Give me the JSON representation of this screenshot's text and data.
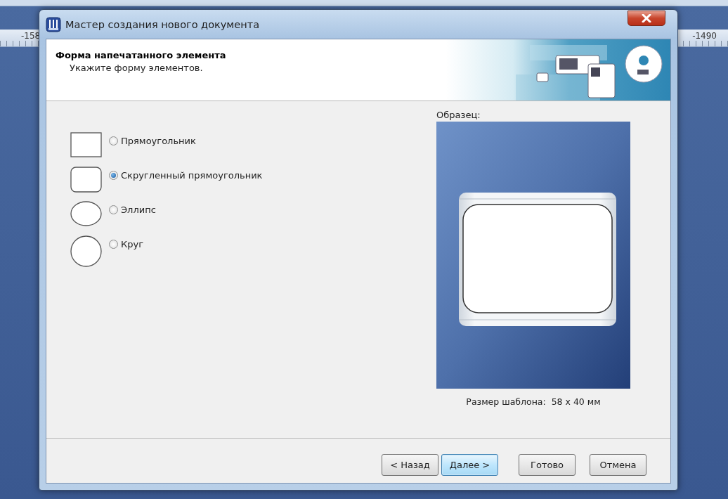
{
  "window": {
    "title": "Мастер создания нового документа"
  },
  "rulers": [
    "-158",
    "-1490"
  ],
  "header": {
    "title": "Форма напечатанного элемента",
    "subtitle": "Укажите форму элементов."
  },
  "shapes": [
    {
      "kind": "rectangle",
      "label": "Прямоугольник",
      "selected": false
    },
    {
      "kind": "rounded",
      "label": "Скругленный прямоугольник",
      "selected": true
    },
    {
      "kind": "ellipse",
      "label": "Эллипс",
      "selected": false
    },
    {
      "kind": "circle",
      "label": "Круг",
      "selected": false
    }
  ],
  "preview": {
    "label": "Образец:",
    "size_caption": "Размер шаблона:  58 x 40 мм"
  },
  "buttons": [
    {
      "label": "< Назад",
      "focused": false
    },
    {
      "label": "Далее >",
      "focused": true
    },
    {
      "label": "Готово",
      "focused": false
    },
    {
      "label": "Отмена",
      "focused": false
    }
  ]
}
